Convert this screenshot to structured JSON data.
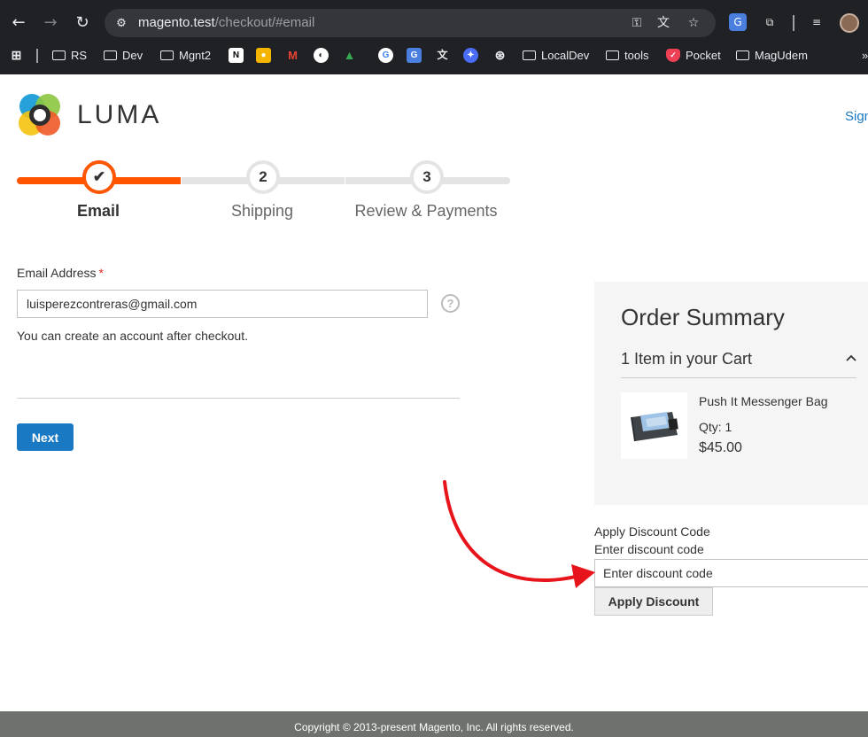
{
  "browser": {
    "url_host": "magento.test",
    "url_path": "/checkout/#email",
    "bookmarks": [
      "RS",
      "Dev",
      "Mgnt2",
      "LocalDev",
      "tools",
      "Pocket",
      "MagUdem"
    ],
    "more": "»"
  },
  "header": {
    "logo_text": "LUMA",
    "sign_in": "Sign"
  },
  "progress": {
    "steps": [
      {
        "number": "✔",
        "label": "Email",
        "state": "active"
      },
      {
        "number": "2",
        "label": "Shipping",
        "state": "todo"
      },
      {
        "number": "3",
        "label": "Review & Payments",
        "state": "todo"
      }
    ],
    "accent_color": "#ff5501"
  },
  "email_form": {
    "label": "Email Address",
    "required_mark": "*",
    "value": "luisperezcontreras@gmail.com",
    "help": "?",
    "note": "You can create an account after checkout.",
    "next_label": "Next"
  },
  "summary": {
    "title": "Order Summary",
    "cart_count": "1 Item in your Cart",
    "item": {
      "name": "Push It Messenger Bag",
      "qty": "Qty: 1",
      "price": "$45.00"
    }
  },
  "discount": {
    "title": "Apply Discount Code",
    "label": "Enter discount code",
    "placeholder": "Enter discount code",
    "button": "Apply Discount"
  },
  "footer": {
    "copyright": "Copyright © 2013-present Magento, Inc. All rights reserved."
  },
  "colors": {
    "primary_button": "#1979c3",
    "annotation_arrow": "#e8141b"
  }
}
